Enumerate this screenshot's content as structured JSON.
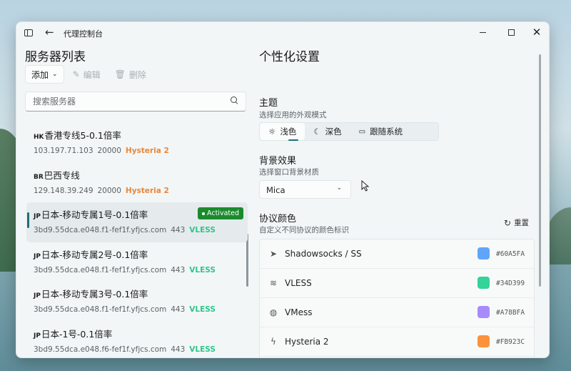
{
  "window": {
    "title": "代理控制台"
  },
  "left": {
    "title": "服务器列表",
    "toolbar": {
      "add_label": "添加",
      "edit_label": "编辑",
      "delete_label": "删除"
    },
    "search": {
      "placeholder": "搜索服务器"
    },
    "servers": [
      {
        "flag": "HK",
        "name": "香港专线5-0.1倍率",
        "host": "103.197.71.103",
        "port": "20000",
        "protocol": "Hysteria 2",
        "active": false
      },
      {
        "flag": "BR",
        "name": "巴西专线",
        "host": "129.148.39.249",
        "port": "20000",
        "protocol": "Hysteria 2",
        "active": false
      },
      {
        "flag": "JP",
        "name": "日本-移动专属1号-0.1倍率",
        "host": "3bd9.55dca.e048.f1-fef1f.yfjcs.com",
        "port": "443",
        "protocol": "VLESS",
        "active": true,
        "badge": "Activated"
      },
      {
        "flag": "JP",
        "name": "日本-移动专属2号-0.1倍率",
        "host": "3bd9.55dca.e048.f1-fef1f.yfjcs.com",
        "port": "443",
        "protocol": "VLESS",
        "active": false
      },
      {
        "flag": "JP",
        "name": "日本-移动专属3号-0.1倍率",
        "host": "3bd9.55dca.e048.f1-fef1f.yfjcs.com",
        "port": "443",
        "protocol": "VLESS",
        "active": false
      },
      {
        "flag": "JP",
        "name": "日本-1号-0.1倍率",
        "host": "3bd9.55dca.e048.f6-fef1f.yfjcs.com",
        "port": "443",
        "protocol": "VLESS",
        "active": false
      }
    ]
  },
  "right": {
    "title": "个性化设置",
    "theme": {
      "title": "主题",
      "subtitle": "选择应用的外观模式",
      "options": [
        "浅色",
        "深色",
        "跟随系统"
      ],
      "selected": "浅色"
    },
    "backdrop": {
      "title": "背景效果",
      "subtitle": "选择窗口背景材质",
      "value": "Mica"
    },
    "protocol_colors": {
      "title": "协议颜色",
      "subtitle": "自定义不同协议的颜色标识",
      "reset_label": "重置",
      "items": [
        {
          "name": "Shadowsocks / SS",
          "hex": "#60A5FA",
          "icon": "send-icon"
        },
        {
          "name": "VLESS",
          "hex": "#34D399",
          "icon": "layers-icon"
        },
        {
          "name": "VMess",
          "hex": "#A78BFA",
          "icon": "globe-icon"
        },
        {
          "name": "Hysteria 2",
          "hex": "#FB923C",
          "icon": "lightning-icon"
        }
      ]
    }
  },
  "colors": {
    "accent": "#1F6E7A",
    "activated": "#1B8A2D",
    "hysteria": "#E8873A",
    "vless": "#2FC58C"
  }
}
